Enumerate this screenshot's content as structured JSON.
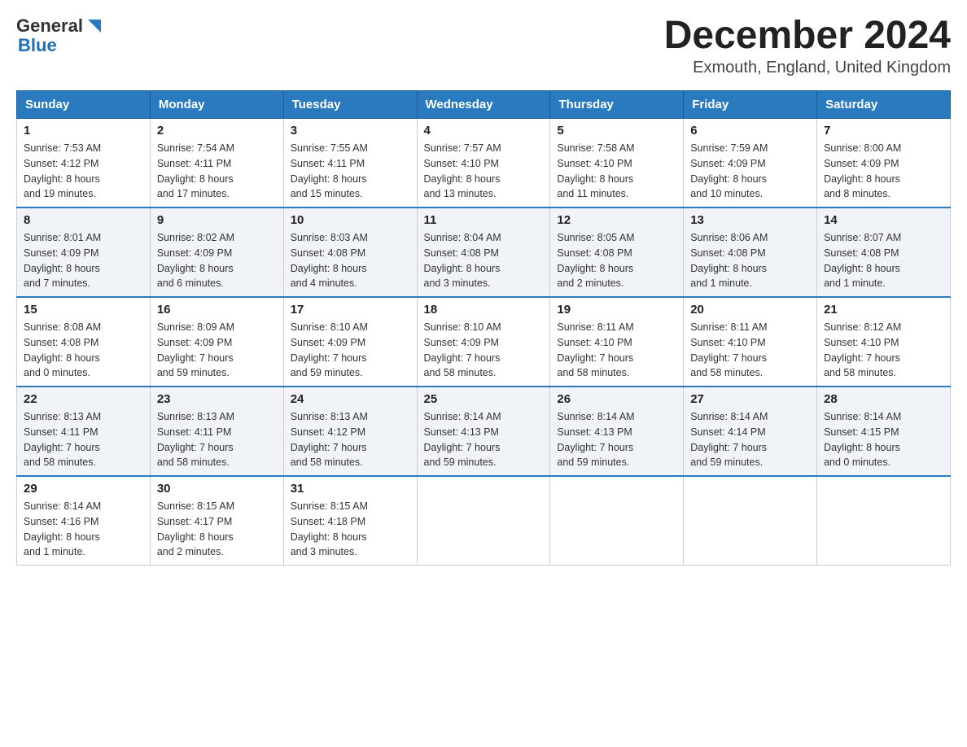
{
  "header": {
    "logo_line1": "General",
    "logo_line2": "Blue",
    "title": "December 2024",
    "location": "Exmouth, England, United Kingdom"
  },
  "weekdays": [
    "Sunday",
    "Monday",
    "Tuesday",
    "Wednesday",
    "Thursday",
    "Friday",
    "Saturday"
  ],
  "weeks": [
    [
      {
        "day": "1",
        "sunrise": "7:53 AM",
        "sunset": "4:12 PM",
        "daylight": "8 hours and 19 minutes."
      },
      {
        "day": "2",
        "sunrise": "7:54 AM",
        "sunset": "4:11 PM",
        "daylight": "8 hours and 17 minutes."
      },
      {
        "day": "3",
        "sunrise": "7:55 AM",
        "sunset": "4:11 PM",
        "daylight": "8 hours and 15 minutes."
      },
      {
        "day": "4",
        "sunrise": "7:57 AM",
        "sunset": "4:10 PM",
        "daylight": "8 hours and 13 minutes."
      },
      {
        "day": "5",
        "sunrise": "7:58 AM",
        "sunset": "4:10 PM",
        "daylight": "8 hours and 11 minutes."
      },
      {
        "day": "6",
        "sunrise": "7:59 AM",
        "sunset": "4:09 PM",
        "daylight": "8 hours and 10 minutes."
      },
      {
        "day": "7",
        "sunrise": "8:00 AM",
        "sunset": "4:09 PM",
        "daylight": "8 hours and 8 minutes."
      }
    ],
    [
      {
        "day": "8",
        "sunrise": "8:01 AM",
        "sunset": "4:09 PM",
        "daylight": "8 hours and 7 minutes."
      },
      {
        "day": "9",
        "sunrise": "8:02 AM",
        "sunset": "4:09 PM",
        "daylight": "8 hours and 6 minutes."
      },
      {
        "day": "10",
        "sunrise": "8:03 AM",
        "sunset": "4:08 PM",
        "daylight": "8 hours and 4 minutes."
      },
      {
        "day": "11",
        "sunrise": "8:04 AM",
        "sunset": "4:08 PM",
        "daylight": "8 hours and 3 minutes."
      },
      {
        "day": "12",
        "sunrise": "8:05 AM",
        "sunset": "4:08 PM",
        "daylight": "8 hours and 2 minutes."
      },
      {
        "day": "13",
        "sunrise": "8:06 AM",
        "sunset": "4:08 PM",
        "daylight": "8 hours and 1 minute."
      },
      {
        "day": "14",
        "sunrise": "8:07 AM",
        "sunset": "4:08 PM",
        "daylight": "8 hours and 1 minute."
      }
    ],
    [
      {
        "day": "15",
        "sunrise": "8:08 AM",
        "sunset": "4:08 PM",
        "daylight": "8 hours and 0 minutes."
      },
      {
        "day": "16",
        "sunrise": "8:09 AM",
        "sunset": "4:09 PM",
        "daylight": "7 hours and 59 minutes."
      },
      {
        "day": "17",
        "sunrise": "8:10 AM",
        "sunset": "4:09 PM",
        "daylight": "7 hours and 59 minutes."
      },
      {
        "day": "18",
        "sunrise": "8:10 AM",
        "sunset": "4:09 PM",
        "daylight": "7 hours and 58 minutes."
      },
      {
        "day": "19",
        "sunrise": "8:11 AM",
        "sunset": "4:10 PM",
        "daylight": "7 hours and 58 minutes."
      },
      {
        "day": "20",
        "sunrise": "8:11 AM",
        "sunset": "4:10 PM",
        "daylight": "7 hours and 58 minutes."
      },
      {
        "day": "21",
        "sunrise": "8:12 AM",
        "sunset": "4:10 PM",
        "daylight": "7 hours and 58 minutes."
      }
    ],
    [
      {
        "day": "22",
        "sunrise": "8:13 AM",
        "sunset": "4:11 PM",
        "daylight": "7 hours and 58 minutes."
      },
      {
        "day": "23",
        "sunrise": "8:13 AM",
        "sunset": "4:11 PM",
        "daylight": "7 hours and 58 minutes."
      },
      {
        "day": "24",
        "sunrise": "8:13 AM",
        "sunset": "4:12 PM",
        "daylight": "7 hours and 58 minutes."
      },
      {
        "day": "25",
        "sunrise": "8:14 AM",
        "sunset": "4:13 PM",
        "daylight": "7 hours and 59 minutes."
      },
      {
        "day": "26",
        "sunrise": "8:14 AM",
        "sunset": "4:13 PM",
        "daylight": "7 hours and 59 minutes."
      },
      {
        "day": "27",
        "sunrise": "8:14 AM",
        "sunset": "4:14 PM",
        "daylight": "7 hours and 59 minutes."
      },
      {
        "day": "28",
        "sunrise": "8:14 AM",
        "sunset": "4:15 PM",
        "daylight": "8 hours and 0 minutes."
      }
    ],
    [
      {
        "day": "29",
        "sunrise": "8:14 AM",
        "sunset": "4:16 PM",
        "daylight": "8 hours and 1 minute."
      },
      {
        "day": "30",
        "sunrise": "8:15 AM",
        "sunset": "4:17 PM",
        "daylight": "8 hours and 2 minutes."
      },
      {
        "day": "31",
        "sunrise": "8:15 AM",
        "sunset": "4:18 PM",
        "daylight": "8 hours and 3 minutes."
      },
      null,
      null,
      null,
      null
    ]
  ],
  "labels": {
    "sunrise": "Sunrise:",
    "sunset": "Sunset:",
    "daylight": "Daylight:"
  }
}
